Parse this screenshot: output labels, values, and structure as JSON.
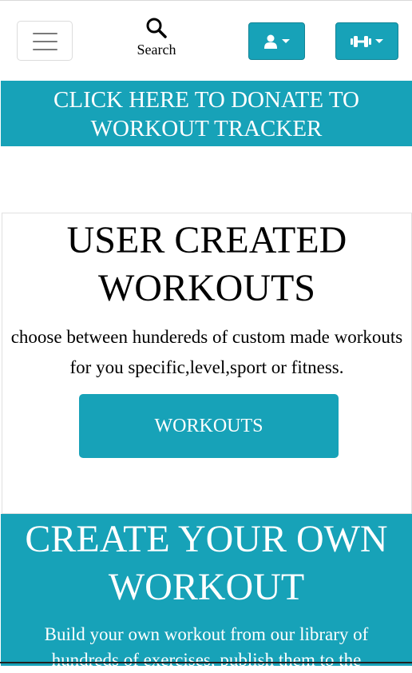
{
  "nav": {
    "search_label": "Search",
    "menu_icon": "hamburger-icon",
    "user_icon": "user-icon",
    "fitness_icon": "dumbbell-icon"
  },
  "donate_banner": "CLICK HERE TO DONATE TO WORKOUT TRACKER",
  "user_workouts": {
    "title": "USER CREATED WORKOUTS",
    "description": "choose between hundereds of custom made workouts for you specific,level,sport or fitness.",
    "button_label": "WORKOUTS"
  },
  "create_section": {
    "title": "CREATE YOUR OWN WORKOUT",
    "description": "Build your own workout from our library of hundreds of exercises, publish them to the"
  },
  "colors": {
    "accent": "#17a2b8",
    "accent_border": "#138496"
  }
}
